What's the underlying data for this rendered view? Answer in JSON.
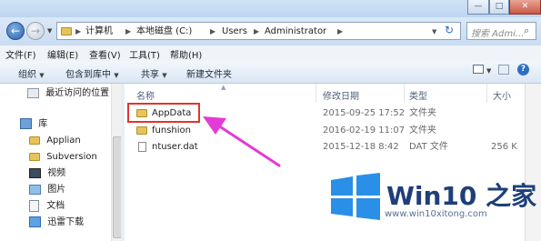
{
  "window": {
    "minimize": "—",
    "maximize": "□",
    "close": "✕"
  },
  "address": {
    "crumbs": [
      "计算机",
      "本地磁盘 (C:)",
      "Users",
      "Administrator"
    ],
    "search_placeholder": "搜索 Admi..."
  },
  "menu": [
    "文件(F)",
    "编辑(E)",
    "查看(V)",
    "工具(T)",
    "帮助(H)"
  ],
  "toolbar": [
    "组织",
    "包含到库中",
    "共享",
    "新建文件夹"
  ],
  "sidebar": {
    "recent": "最近访问的位置",
    "library": "库",
    "items": [
      "Applian",
      "Subversion",
      "视频",
      "图片",
      "文档",
      "迅雷下载"
    ]
  },
  "columns": {
    "name": "名称",
    "modified": "修改日期",
    "type": "类型",
    "size": "大小"
  },
  "files": [
    {
      "name": "AppData",
      "modified": "2015-09-25 17:52",
      "type": "文件夹",
      "size": ""
    },
    {
      "name": "funshion",
      "modified": "2016-02-19 11:07",
      "type": "文件夹",
      "size": ""
    },
    {
      "name": "ntuser.dat",
      "modified": "2015-12-18 8:42",
      "type": "DAT 文件",
      "size": "256 K"
    }
  ],
  "watermark": {
    "brand": "Win10 之家",
    "url": "www.win10xitong.com"
  },
  "colors": {
    "highlight": "#e0362e",
    "arrow": "#e33bd6",
    "logo_blue": "#2a8fe6"
  }
}
